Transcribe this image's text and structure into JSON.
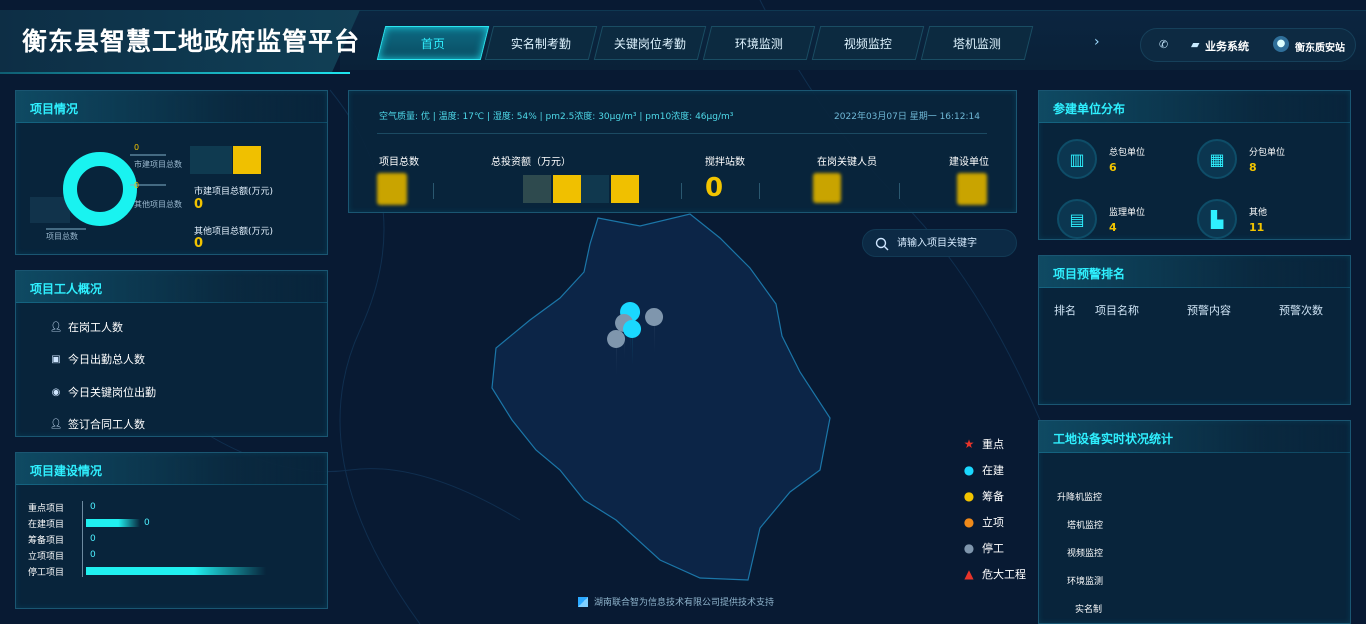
{
  "header": {
    "title": "衡东县智慧工地政府监管平台",
    "tabs": [
      "首页",
      "实名制考勤",
      "关键岗位考勤",
      "环境监测",
      "视频监控",
      "塔机监测"
    ],
    "active_tab": "首页",
    "more_icon": "chevron-right-icon",
    "business_system": "业务系统",
    "user_name": "衡东质安站"
  },
  "project_overview": {
    "title": "项目情况",
    "donut_labels": {
      "city": "市建项目总数",
      "other": "其他项目总数",
      "total": "项目总数"
    },
    "donut_values": {
      "city": "0",
      "other": "0"
    },
    "city_amount_label": "市建项目总额(万元)",
    "city_amount_value": "0",
    "other_amount_label": "其他项目总额(万元)",
    "other_amount_value": "0"
  },
  "workers": {
    "title": "项目工人概况",
    "items": [
      "在岗工人数",
      "今日出勤总人数",
      "今日关键岗位出勤",
      "签订合同工人数"
    ]
  },
  "construction": {
    "title": "项目建设情况",
    "rows": [
      {
        "label": "重点项目",
        "value": "0",
        "fill": 0
      },
      {
        "label": "在建项目",
        "value": "0",
        "fill": 0.3
      },
      {
        "label": "筹备项目",
        "value": "0",
        "fill": 0
      },
      {
        "label": "立项项目",
        "value": "0",
        "fill": 0
      },
      {
        "label": "停工项目",
        "value": "",
        "fill": 1.0
      }
    ]
  },
  "stats": {
    "info": "空气质量: 优   |   温度: 17℃   |   湿度: 54%   |   pm2.5浓度: 30μg/m³   |   pm10浓度: 46μg/m³",
    "time": "2022年03月07日 星期一 16:12:14",
    "labels": [
      "项目总数",
      "总投资额（万元）",
      "搅拌站数",
      "在岗关键人员",
      "建设单位"
    ],
    "mixing_station_value": "0"
  },
  "search": {
    "placeholder": "请输入项目关键字"
  },
  "map_legend": [
    {
      "label": "重点",
      "icon": "star-icon",
      "color": "#e8342a"
    },
    {
      "label": "在建",
      "icon": "pin-icon",
      "color": "#1ad8ff"
    },
    {
      "label": "筹备",
      "icon": "pin-icon",
      "color": "#f2c400"
    },
    {
      "label": "立项",
      "icon": "pin-icon",
      "color": "#f08a1a"
    },
    {
      "label": "停工",
      "icon": "pin-icon",
      "color": "#7f96ad"
    },
    {
      "label": "危大工程",
      "icon": "warning-icon",
      "color": "#e8342a"
    }
  ],
  "footer": {
    "credit": "湖南联合智为信息技术有限公司提供技术支持"
  },
  "units": {
    "title": "参建单位分布",
    "items": [
      {
        "name": "总包单位",
        "value": "6"
      },
      {
        "name": "分包单位",
        "value": "8"
      },
      {
        "name": "监理单位",
        "value": "4"
      },
      {
        "name": "其他",
        "value": "11"
      }
    ]
  },
  "warnings": {
    "title": "项目预警排名",
    "headers": [
      "排名",
      "项目名称",
      "预警内容",
      "预警次数"
    ]
  },
  "devices": {
    "title": "工地设备实时状况统计",
    "labels": [
      "升降机监控",
      "塔机监控",
      "视频监控",
      "环境监测",
      "实名制"
    ]
  }
}
